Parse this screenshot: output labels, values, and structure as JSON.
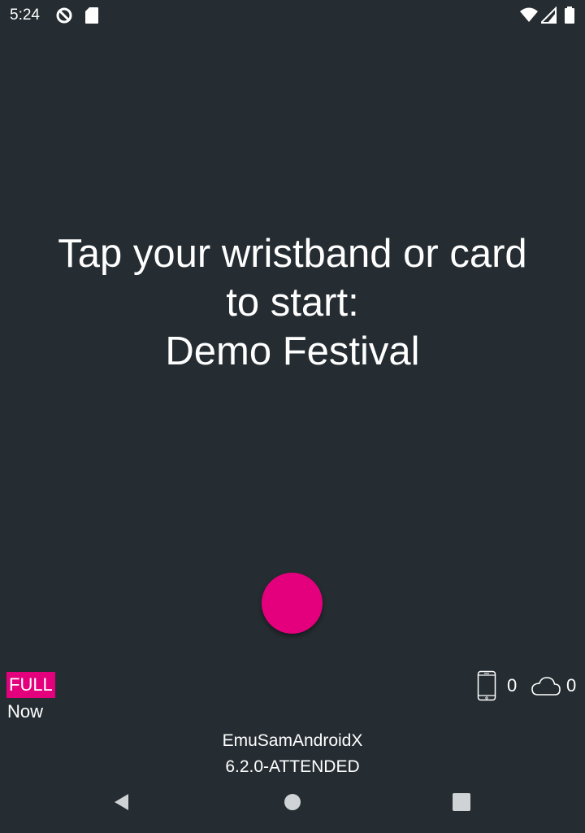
{
  "status_bar": {
    "time": "5:24",
    "icons": [
      "data-saver-icon",
      "sd-card-icon",
      "wifi-icon",
      "signal-icon",
      "battery-icon"
    ]
  },
  "message": {
    "line1": "Tap your wristband or card",
    "line2": "to start:",
    "event_name": "Demo Festival"
  },
  "indicator": {
    "color": "#e4007d"
  },
  "mode": {
    "label": "FULL",
    "time": "Now"
  },
  "counters": {
    "device_count": "0",
    "cloud_count": "0"
  },
  "footer": {
    "device_name": "EmuSamAndroidX",
    "version": "6.2.0-ATTENDED"
  },
  "nav": {
    "icons": [
      "back-icon",
      "home-icon",
      "recents-icon"
    ]
  },
  "colors": {
    "background": "#252d32",
    "accent": "#e4007d",
    "text": "#ffffff"
  }
}
